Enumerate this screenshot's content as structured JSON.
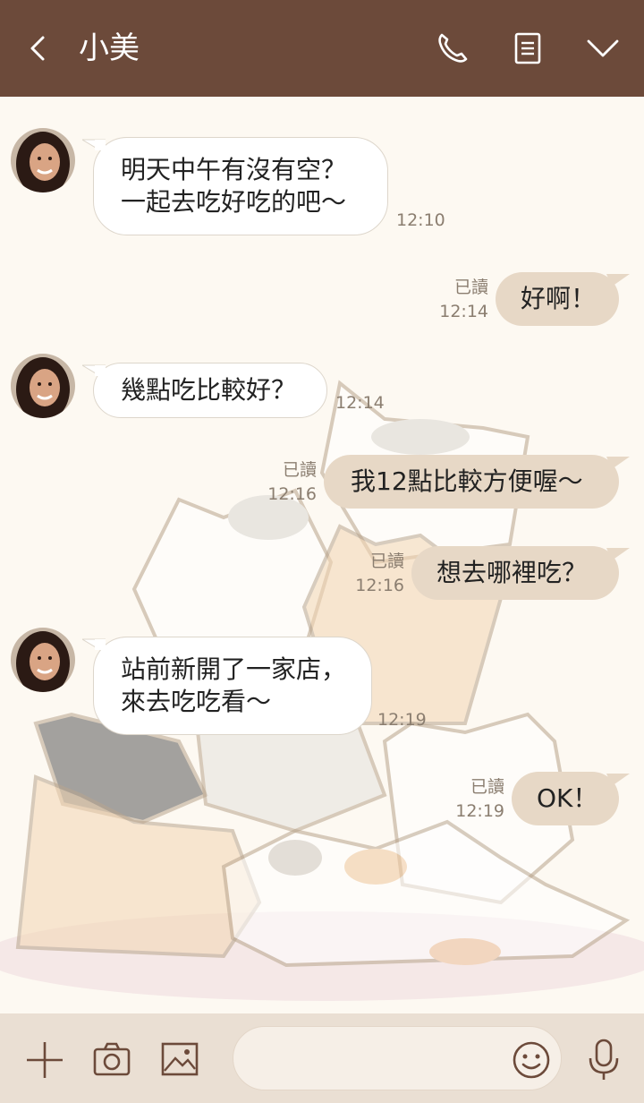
{
  "header": {
    "title": "小美",
    "bg_color": "#6c4a3a",
    "icons": [
      "back-icon",
      "phone-icon",
      "notes-icon",
      "chevron-down-icon"
    ]
  },
  "messages": [
    {
      "side": "in",
      "lines": [
        "明天中午有沒有空？",
        "一起去吃好吃的吧～"
      ],
      "time": "12:10"
    },
    {
      "side": "out",
      "lines": [
        "好啊！"
      ],
      "read": "已讀",
      "time": "12:14"
    },
    {
      "side": "in",
      "lines": [
        "幾點吃比較好？"
      ],
      "time": "12:14"
    },
    {
      "side": "out",
      "lines": [
        "我12點比較方便喔～"
      ],
      "read": "已讀",
      "time": "12:16"
    },
    {
      "side": "out",
      "lines": [
        "想去哪裡吃？"
      ],
      "read": "已讀",
      "time": "12:16"
    },
    {
      "side": "in",
      "lines": [
        "站前新開了一家店，",
        "來去吃吃看～"
      ],
      "time": "12:19"
    },
    {
      "side": "out",
      "lines": [
        "OK！"
      ],
      "read": "已讀",
      "time": "12:19"
    }
  ],
  "bottom": {
    "icons": [
      "plus-icon",
      "camera-icon",
      "image-icon",
      "emoji-icon",
      "microphone-icon"
    ],
    "input_value": "",
    "input_placeholder": ""
  },
  "colors": {
    "outgoing_bubble": "#e7d8c6",
    "incoming_bubble": "#ffffff",
    "background": "#fdf9f2",
    "bottom_bar": "#eadfd3"
  }
}
